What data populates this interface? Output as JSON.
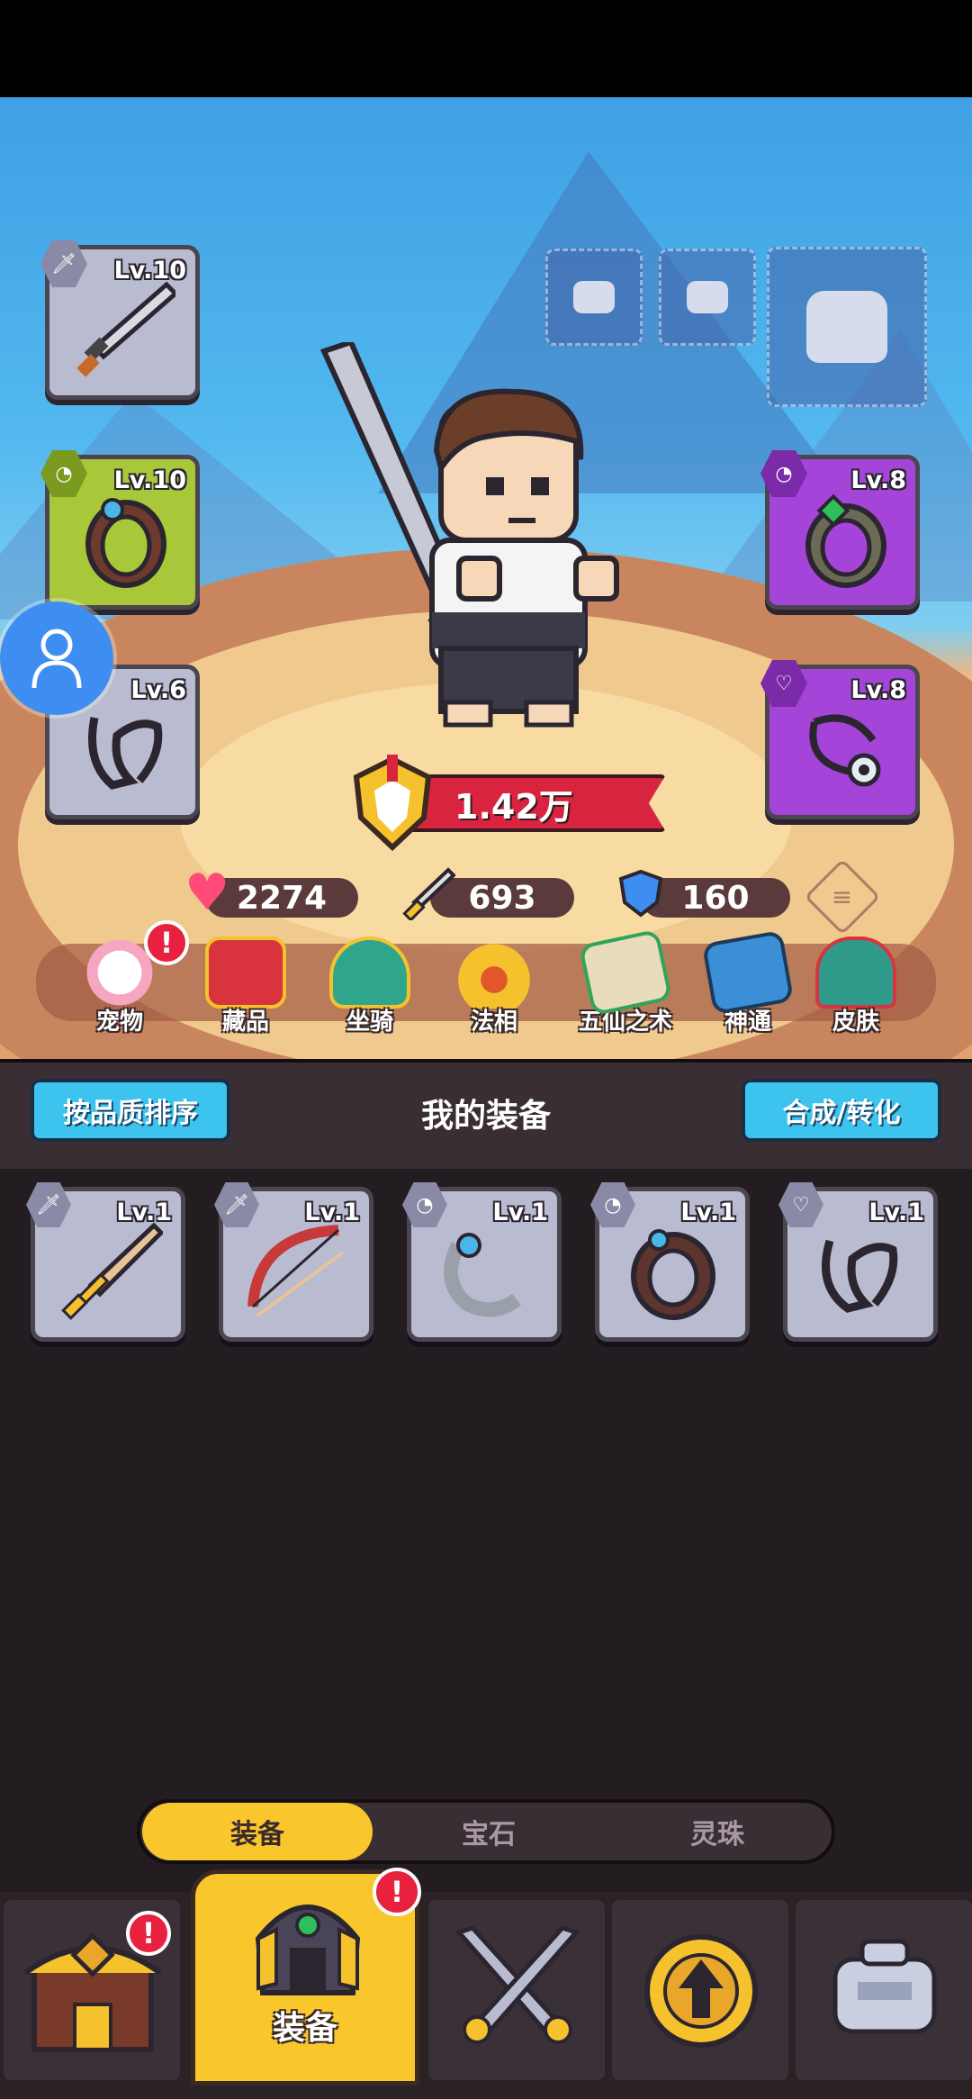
{
  "hero": {
    "power": "1.42万",
    "stats": {
      "hp": "2274",
      "attack": "693",
      "defense": "160"
    }
  },
  "equipped": {
    "weapon": {
      "level": "Lv.10",
      "icon": "sword-icon"
    },
    "ring": {
      "level": "Lv.10",
      "icon": "ring-icon"
    },
    "necklace": {
      "level": "Lv.6",
      "icon": "necklace-icon"
    },
    "right_ring": {
      "level": "Lv.8",
      "icon": "ring-icon"
    },
    "right_necklace": {
      "level": "Lv.8",
      "icon": "pendant-icon"
    }
  },
  "features": [
    {
      "label": "宠物",
      "icon": "pet-icon",
      "alert": "!"
    },
    {
      "label": "藏品",
      "icon": "treasure-chest-icon"
    },
    {
      "label": "坐骑",
      "icon": "mount-icon"
    },
    {
      "label": "法相",
      "icon": "incense-burner-icon"
    },
    {
      "label": "五仙之术",
      "icon": "scroll-icon"
    },
    {
      "label": "神通",
      "icon": "spellbook-icon"
    },
    {
      "label": "皮肤",
      "icon": "helmet-icon"
    }
  ],
  "panel": {
    "sort_button": "按品质排序",
    "title": "我的装备",
    "merge_button": "合成/转化"
  },
  "inventory": [
    {
      "level": "Lv.1",
      "icon": "sword-icon"
    },
    {
      "level": "Lv.1",
      "icon": "bow-icon"
    },
    {
      "level": "Lv.1",
      "icon": "bracelet-icon"
    },
    {
      "level": "Lv.1",
      "icon": "ring-icon"
    },
    {
      "level": "Lv.1",
      "icon": "necklace-icon"
    }
  ],
  "tabs": {
    "equipment": "装备",
    "gems": "宝石",
    "beads": "灵珠"
  },
  "bottom_nav": {
    "active_label": "装备",
    "alert": "!",
    "items": [
      "shop-icon",
      "equipment-helmet-icon",
      "battle-swords-icon",
      "upgrade-arrow-icon",
      "robot-icon"
    ]
  },
  "colors": {
    "accent_yellow": "#f9c62c",
    "button_cyan": "#3cc3ee",
    "purple_rarity": "#a444d8",
    "green_rarity": "#a8c83a"
  }
}
